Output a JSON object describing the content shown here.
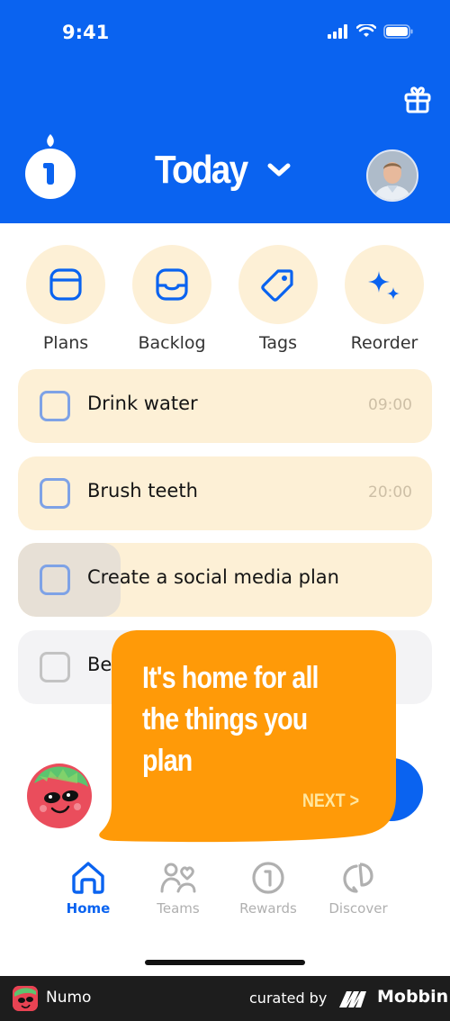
{
  "status_bar": {
    "time": "9:41"
  },
  "header": {
    "title": "Today"
  },
  "quick_actions": [
    {
      "label": "Plans",
      "icon": "calendar-icon"
    },
    {
      "label": "Backlog",
      "icon": "inbox-icon"
    },
    {
      "label": "Tags",
      "icon": "tag-icon"
    },
    {
      "label": "Reorder",
      "icon": "sparkle-icon"
    }
  ],
  "tasks": [
    {
      "name": "Drink water",
      "time": "09:00"
    },
    {
      "name": "Brush teeth",
      "time": "20:00"
    },
    {
      "name": "Create a social media plan",
      "time": ""
    },
    {
      "name": "Be",
      "time": ""
    }
  ],
  "tooltip": {
    "text_line1": "It's home for all",
    "text_line2": "the things you",
    "text_line3": "plan",
    "next_label": "NEXT >"
  },
  "tabbar": [
    {
      "label": "Home",
      "icon": "home-icon",
      "active": true
    },
    {
      "label": "Teams",
      "icon": "teams-icon",
      "active": false
    },
    {
      "label": "Rewards",
      "icon": "rewards-icon",
      "active": false
    },
    {
      "label": "Discover",
      "icon": "discover-icon",
      "active": false
    }
  ],
  "footer": {
    "app_name": "Numo",
    "curated_by": "curated by",
    "brand": "Mobbin"
  },
  "colors": {
    "primary": "#0a63f0",
    "task_bg": "#fdf0d6",
    "tooltip": "#ff9a08"
  }
}
